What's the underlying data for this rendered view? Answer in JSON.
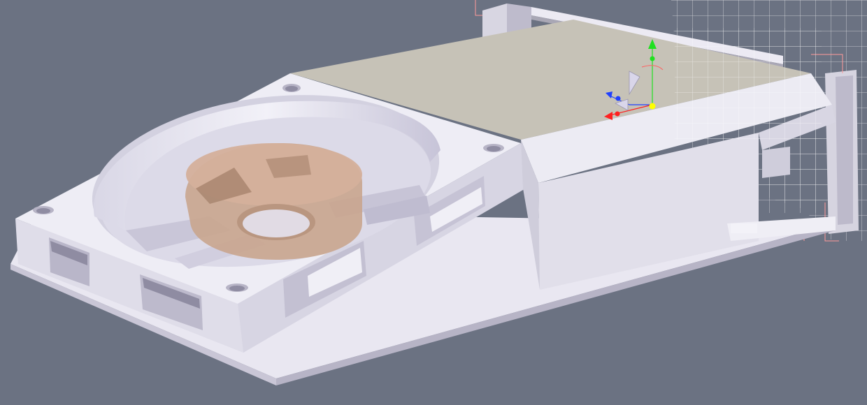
{
  "viewport": {
    "background_color": "#6b7282",
    "model_color": "#e7e5ef",
    "model_shadow_color": "#c9c6d6",
    "lid_top_color": "#c6c2b7",
    "fan_hub_color": "#c9a58e",
    "wireframe_color": "#ffffff",
    "construction_line_color": "#ff9a9a"
  },
  "gizmo": {
    "x_axis_color": "#ff2020",
    "y_axis_color": "#20e020",
    "z_axis_color": "#2040ff",
    "origin_color": "#ffff00",
    "icon": "transform-gizmo-icon"
  }
}
